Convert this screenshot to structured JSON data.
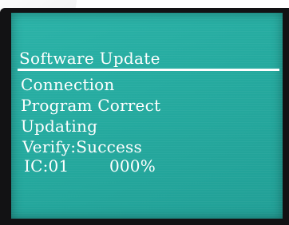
{
  "screen": {
    "title": "Software Update",
    "lines": [
      "Connection",
      "Program Correct",
      "Updating",
      "Verify:Success"
    ],
    "ic": {
      "label": "IC:01",
      "progress": "000%"
    }
  },
  "colors": {
    "screen_background": "#25aa9f",
    "text": "#ffffff",
    "bezel": "#121214"
  }
}
